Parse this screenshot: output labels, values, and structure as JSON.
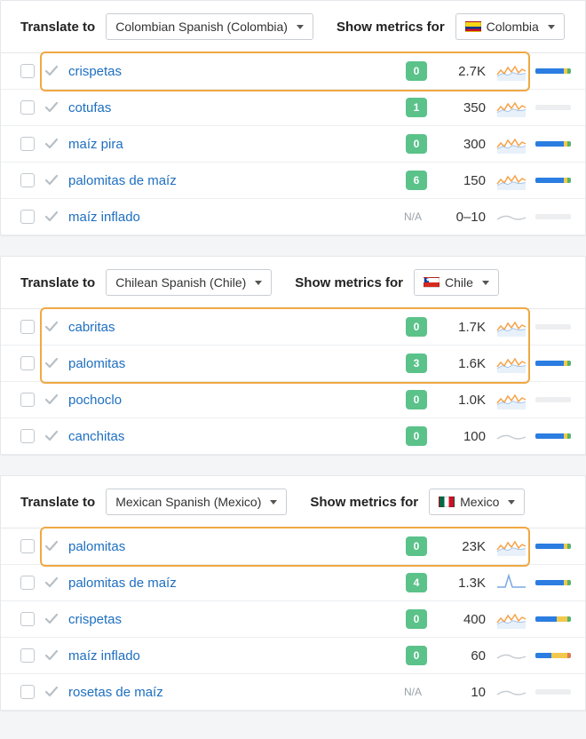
{
  "labels": {
    "translate_to": "Translate to",
    "show_metrics_for": "Show metrics for"
  },
  "sections": [
    {
      "id": "colombia",
      "language": "Colombian Spanish (Colombia)",
      "country": "Colombia",
      "flag": "flag-co",
      "highlight": {
        "start": 0,
        "end": 0
      },
      "rows": [
        {
          "term": "crispetas",
          "badge": "0",
          "volume": "2.7K",
          "spark": "orange",
          "bar": "blue"
        },
        {
          "term": "cotufas",
          "badge": "1",
          "volume": "350",
          "spark": "orange",
          "bar": "empty"
        },
        {
          "term": "maíz pira",
          "badge": "0",
          "volume": "300",
          "spark": "orange",
          "bar": "blue"
        },
        {
          "term": "palomitas de maíz",
          "badge": "6",
          "volume": "150",
          "spark": "orange",
          "bar": "blue"
        },
        {
          "term": "maíz inflado",
          "badge": "N/A",
          "volume": "0–10",
          "spark": "grey",
          "bar": "empty"
        }
      ]
    },
    {
      "id": "chile",
      "language": "Chilean Spanish (Chile)",
      "country": "Chile",
      "flag": "flag-cl",
      "highlight": {
        "start": 0,
        "end": 1
      },
      "rows": [
        {
          "term": "cabritas",
          "badge": "0",
          "volume": "1.7K",
          "spark": "orange",
          "bar": "empty"
        },
        {
          "term": "palomitas",
          "badge": "3",
          "volume": "1.6K",
          "spark": "orange",
          "bar": "blue"
        },
        {
          "term": "pochoclo",
          "badge": "0",
          "volume": "1.0K",
          "spark": "orange",
          "bar": "empty"
        },
        {
          "term": "canchitas",
          "badge": "0",
          "volume": "100",
          "spark": "grey",
          "bar": "blue"
        }
      ]
    },
    {
      "id": "mexico",
      "language": "Mexican Spanish (Mexico)",
      "country": "Mexico",
      "flag": "flag-mx",
      "highlight": {
        "start": 0,
        "end": 0
      },
      "rows": [
        {
          "term": "palomitas",
          "badge": "0",
          "volume": "23K",
          "spark": "orange",
          "bar": "blue"
        },
        {
          "term": "palomitas de maíz",
          "badge": "4",
          "volume": "1.3K",
          "spark": "spike",
          "bar": "blue"
        },
        {
          "term": "crispetas",
          "badge": "0",
          "volume": "400",
          "spark": "orange",
          "bar": "mostlyblue"
        },
        {
          "term": "maíz inflado",
          "badge": "0",
          "volume": "60",
          "spark": "grey",
          "bar": "halfblue"
        },
        {
          "term": "rosetas de maíz",
          "badge": "N/A",
          "volume": "10",
          "spark": "grey",
          "bar": "empty"
        }
      ]
    }
  ]
}
